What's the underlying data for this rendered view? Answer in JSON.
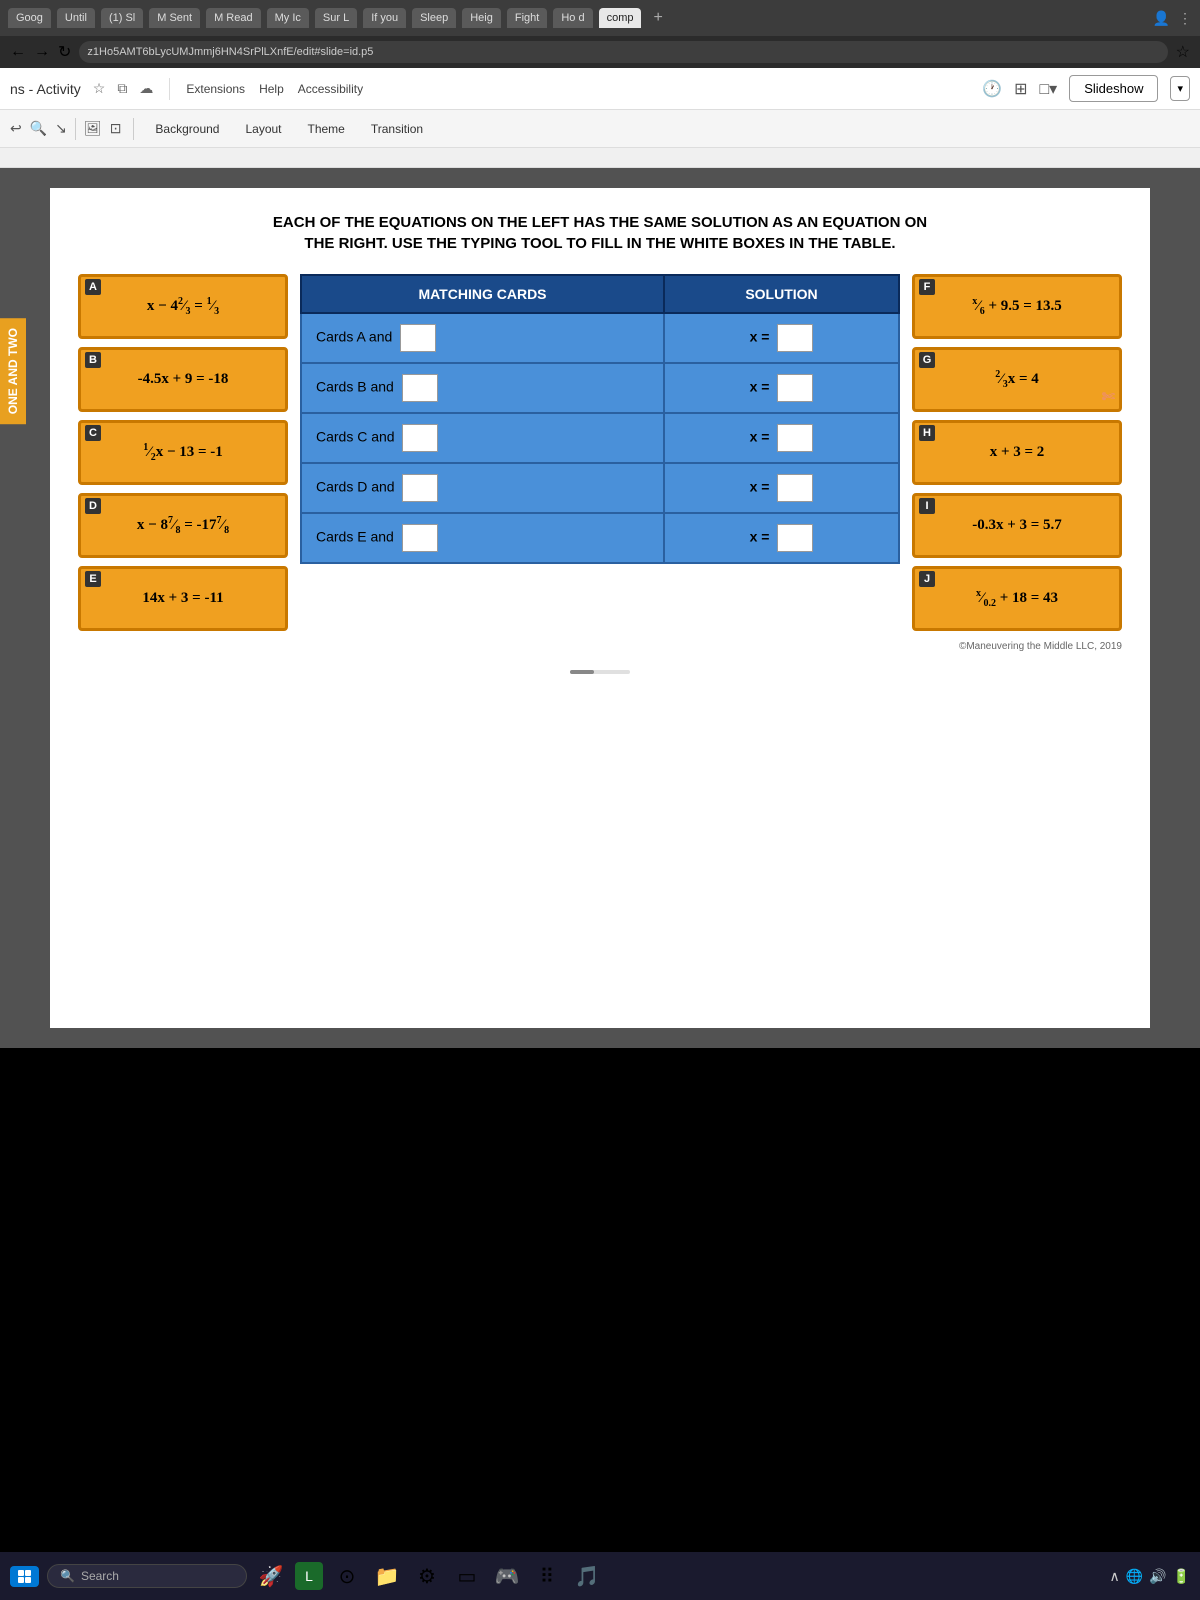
{
  "browser": {
    "tabs": [
      {
        "label": "Goog",
        "active": false
      },
      {
        "label": "Until",
        "active": false
      },
      {
        "label": "(1) Sl",
        "active": false
      },
      {
        "label": "M Sent",
        "active": false
      },
      {
        "label": "M Read",
        "active": false
      },
      {
        "label": "My Ic",
        "active": false
      },
      {
        "label": "Sur L",
        "active": false
      },
      {
        "label": "If you",
        "active": false
      },
      {
        "label": "Sleep",
        "active": false
      },
      {
        "label": "Heig",
        "active": false
      },
      {
        "label": "Fight",
        "active": false
      },
      {
        "label": "Ho d",
        "active": false
      },
      {
        "label": "comp",
        "active": true
      }
    ],
    "address": "z1Ho5AMT6bLycUMJmmj6HN4SrPlLXnfE/edit#slide=id.p5"
  },
  "app": {
    "title": "ns - Activity",
    "menu": [
      "Extensions",
      "Help",
      "Accessibility"
    ],
    "slideshow_label": "Slideshow",
    "toolbar_buttons": [
      "Background",
      "Layout",
      "Theme",
      "Transition"
    ]
  },
  "slide": {
    "heading_line1": "EACH OF THE EQUATIONS ON THE LEFT HAS THE SAME SOLUTION AS AN EQUATION ON",
    "heading_line2": "THE RIGHT. USE THE TYPING TOOL TO FILL IN THE WHITE BOXES IN THE TABLE.",
    "left_tab_text": "ONE AND TWO",
    "equations_left": [
      {
        "label": "A",
        "equation": "x − 4²⁄₃ = ¹⁄₃"
      },
      {
        "label": "B",
        "equation": "-4.5x + 9 = -18"
      },
      {
        "label": "C",
        "equation": "½x − 13 = -1"
      },
      {
        "label": "D",
        "equation": "x − 8⁷⁄₈ = -17⁷⁄₈"
      },
      {
        "label": "E",
        "equation": "14x + 3 = -11"
      }
    ],
    "equations_right": [
      {
        "label": "F",
        "equation": "x/6 + 9.5 = 13.5"
      },
      {
        "label": "G",
        "equation": "²⁄₃x = 4"
      },
      {
        "label": "H",
        "equation": "x + 3 = 2"
      },
      {
        "label": "I",
        "equation": "-0.3x + 3 = 5.7"
      },
      {
        "label": "J",
        "equation": "x/0.2 + 18 = 43"
      }
    ],
    "table": {
      "col1_header": "MATCHING CARDS",
      "col2_header": "SOLUTION",
      "rows": [
        {
          "cards": "Cards A and",
          "x_label": "x ="
        },
        {
          "cards": "Cards B and",
          "x_label": "x ="
        },
        {
          "cards": "Cards C and",
          "x_label": "x ="
        },
        {
          "cards": "Cards D and",
          "x_label": "x ="
        },
        {
          "cards": "Cards E and",
          "x_label": "x ="
        }
      ]
    },
    "copyright": "©Maneuvering the Middle LLC, 2019"
  },
  "taskbar": {
    "search_placeholder": "Search",
    "icons": [
      "🚀",
      "L",
      "⊙",
      "📁",
      "⚙",
      "▭",
      "🎮",
      "≡",
      "🎵"
    ],
    "time": "4))  📥"
  }
}
